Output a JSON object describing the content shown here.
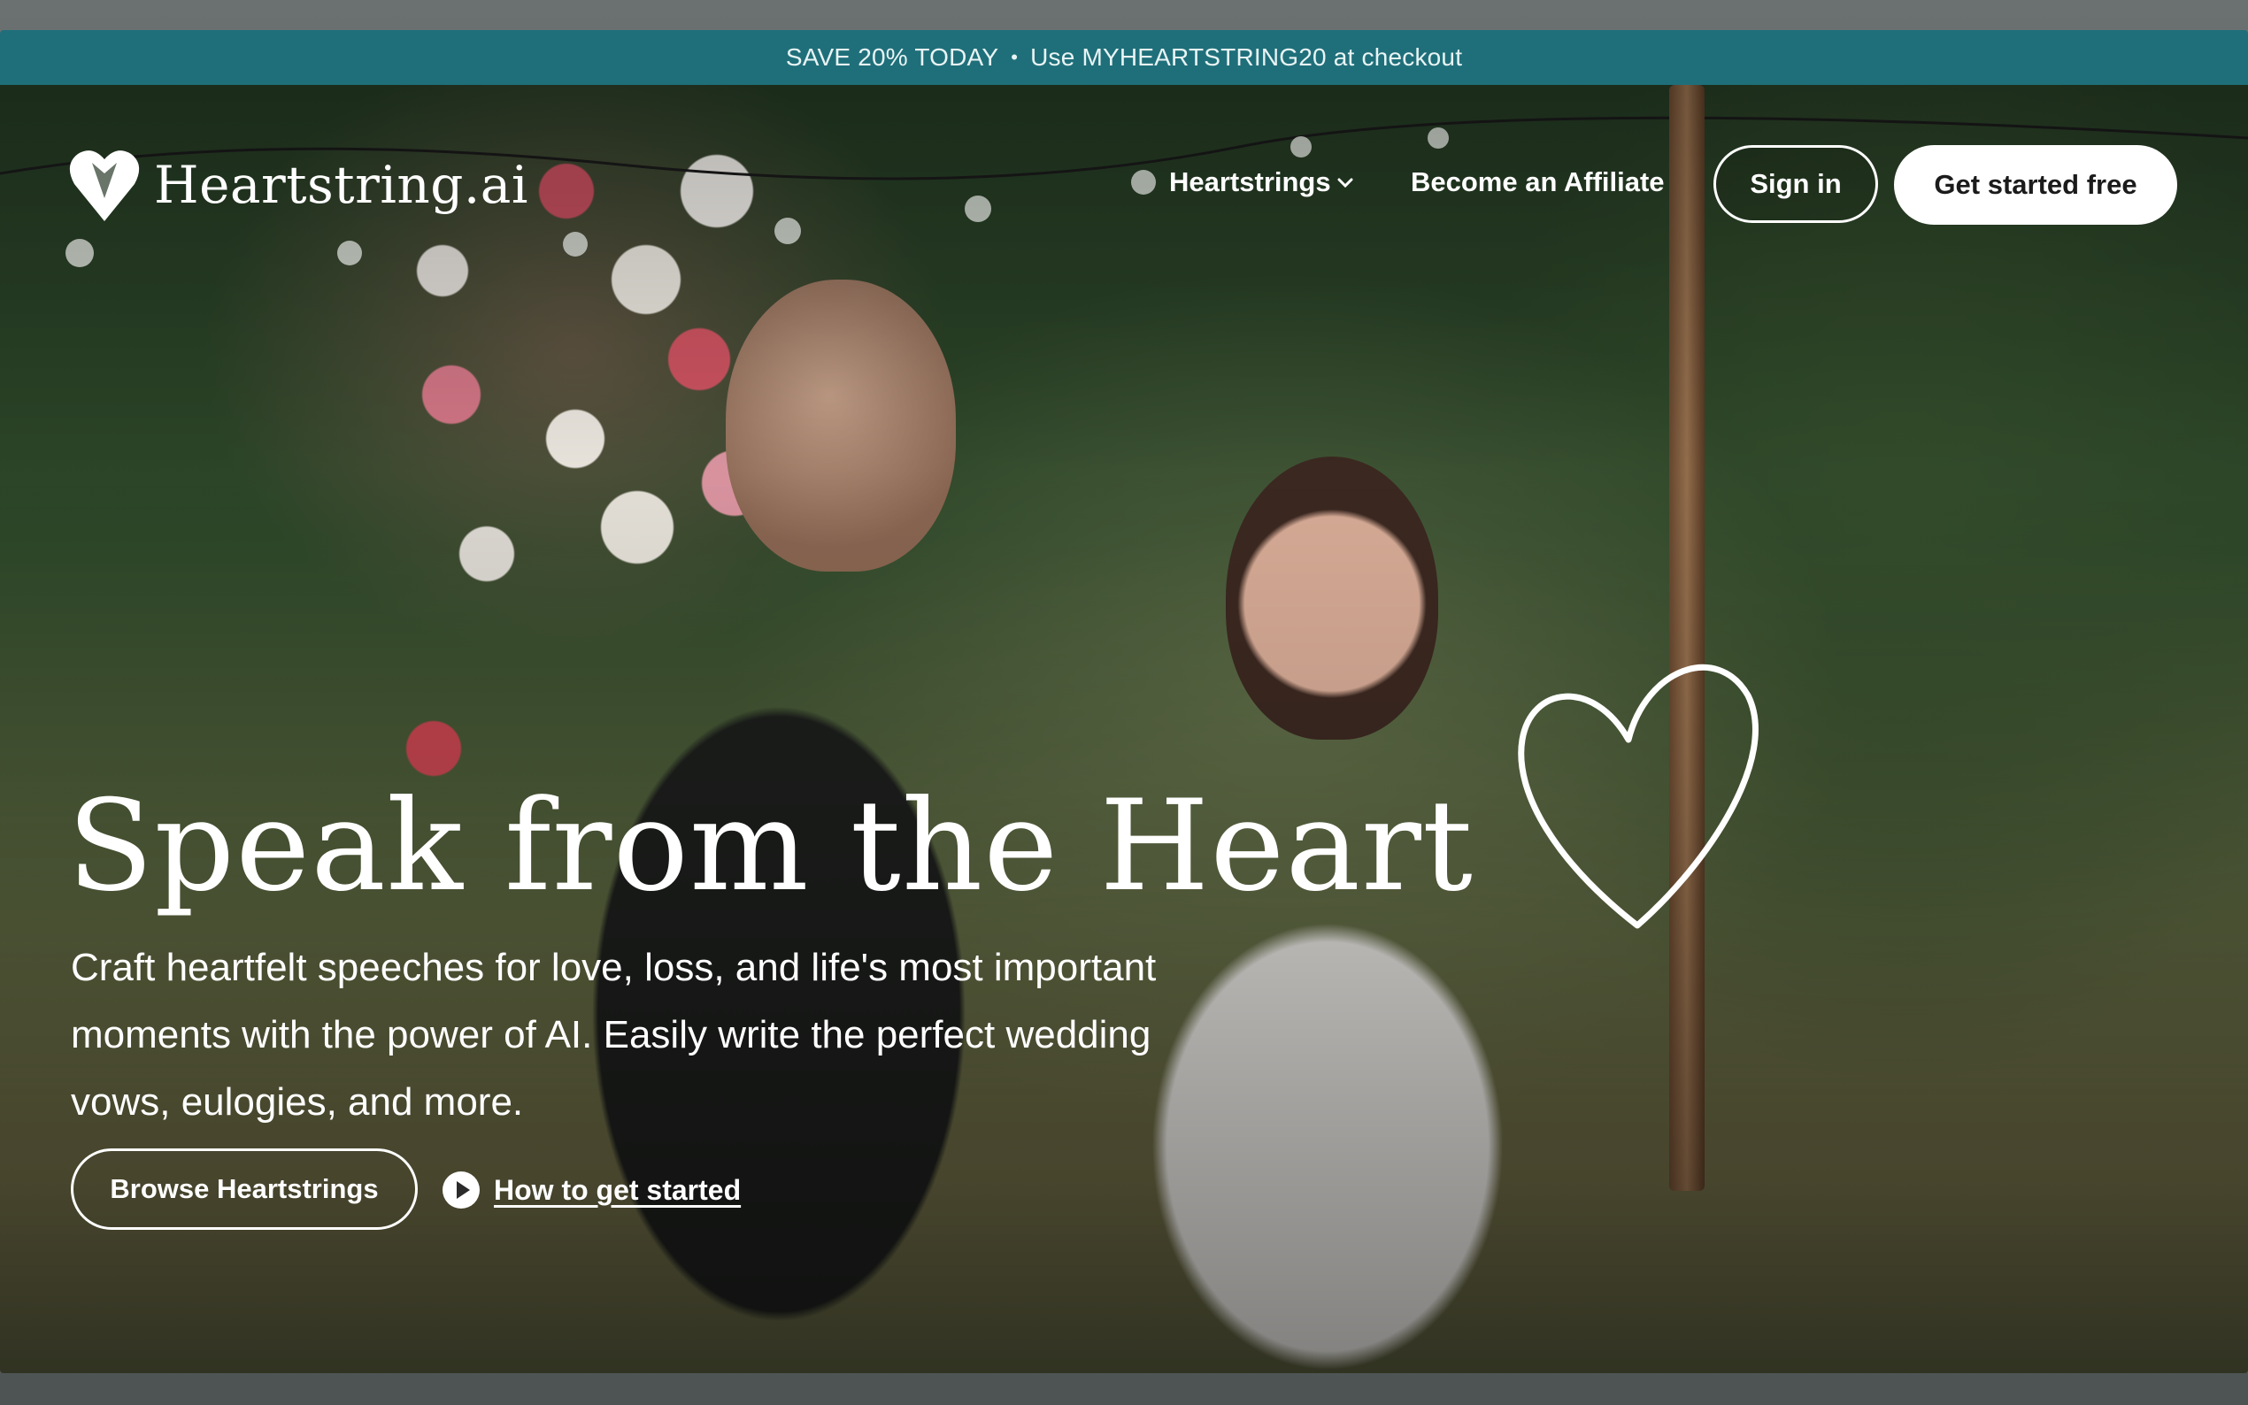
{
  "promo": {
    "left_text": "SAVE 20% TODAY",
    "separator": "•",
    "right_text": "Use MYHEARTSTRING20 at checkout"
  },
  "nav": {
    "brand": "Heartstring.ai",
    "brand_icon": "heart-logo-icon",
    "links": {
      "heartstrings": "Heartstrings",
      "affiliate": "Become an Affiliate"
    },
    "dropdown_icon": "chevron-down-icon",
    "sign_in": "Sign in",
    "get_started": "Get started free"
  },
  "hero": {
    "headline": "Speak from the Heart",
    "subtitle": "Craft heartfelt speeches for love, loss, and life's most important moments with the power of AI. Easily write the perfect wedding vows, eulogies, and more.",
    "browse_button": "Browse Heartstrings",
    "how_link": "How to get started",
    "how_icon": "play-circle-icon"
  },
  "colors": {
    "promo_bg": "#1f6f7a",
    "text_on_image": "#ffffff",
    "primary_button_bg": "#ffffff",
    "primary_button_text": "#1b1b1b"
  }
}
